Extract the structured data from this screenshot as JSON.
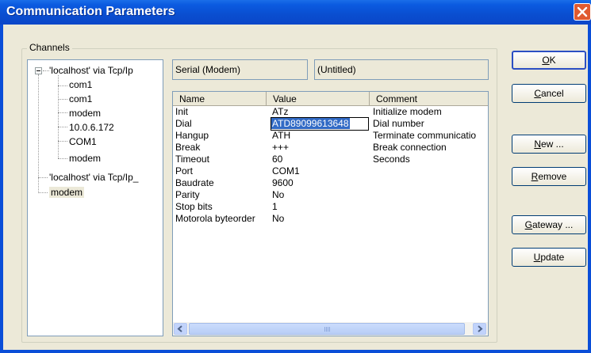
{
  "window": {
    "title": "Communication Parameters"
  },
  "channels": {
    "label": "Channels",
    "tree": [
      {
        "label": "'localhost' via Tcp/Ip",
        "level": 0
      },
      {
        "label": "com1",
        "level": 1
      },
      {
        "label": "com1",
        "level": 1
      },
      {
        "label": "modem",
        "level": 1
      },
      {
        "label": "10.0.6.172",
        "level": 1
      },
      {
        "label": "COM1",
        "level": 1
      },
      {
        "label": "modem",
        "level": 1
      },
      {
        "label": "'localhost' via Tcp/Ip_",
        "level": 0
      },
      {
        "label": "modem",
        "level": 0,
        "selected": true
      }
    ]
  },
  "fields": {
    "device": "Serial (Modem)",
    "name": "(Untitled)"
  },
  "grid": {
    "headers": [
      "Name",
      "Value",
      "Comment"
    ],
    "rows": [
      {
        "name": "Init",
        "value": "ATz",
        "comment": "Initialize modem"
      },
      {
        "name": "Dial",
        "value": "ATD89099613648",
        "comment": "Dial number",
        "editing": true
      },
      {
        "name": "Hangup",
        "value": "ATH",
        "comment": "Terminate communicatio"
      },
      {
        "name": "Break",
        "value": "+++",
        "comment": "Break connection"
      },
      {
        "name": "Timeout",
        "value": "60",
        "comment": "Seconds"
      },
      {
        "name": "Port",
        "value": "COM1",
        "comment": ""
      },
      {
        "name": "Baudrate",
        "value": "9600",
        "comment": ""
      },
      {
        "name": "Parity",
        "value": "No",
        "comment": ""
      },
      {
        "name": "Stop bits",
        "value": "1",
        "comment": ""
      },
      {
        "name": "Motorola byteorder",
        "value": "No",
        "comment": ""
      }
    ]
  },
  "buttons": {
    "ok": {
      "mnemonic": "O",
      "rest": "K"
    },
    "cancel": {
      "mnemonic": "C",
      "rest": "ancel"
    },
    "new": {
      "mnemonic": "N",
      "rest": "ew ..."
    },
    "remove": {
      "mnemonic": "R",
      "rest": "emove"
    },
    "gateway": {
      "mnemonic": "G",
      "rest": "ateway ..."
    },
    "update": {
      "mnemonic": "U",
      "rest": "pdate"
    }
  },
  "colors": {
    "title_bar": "#0a4ed8",
    "dialog_bg": "#ece9d8",
    "selection": "#316ac5",
    "close_button": "#e05a30"
  }
}
